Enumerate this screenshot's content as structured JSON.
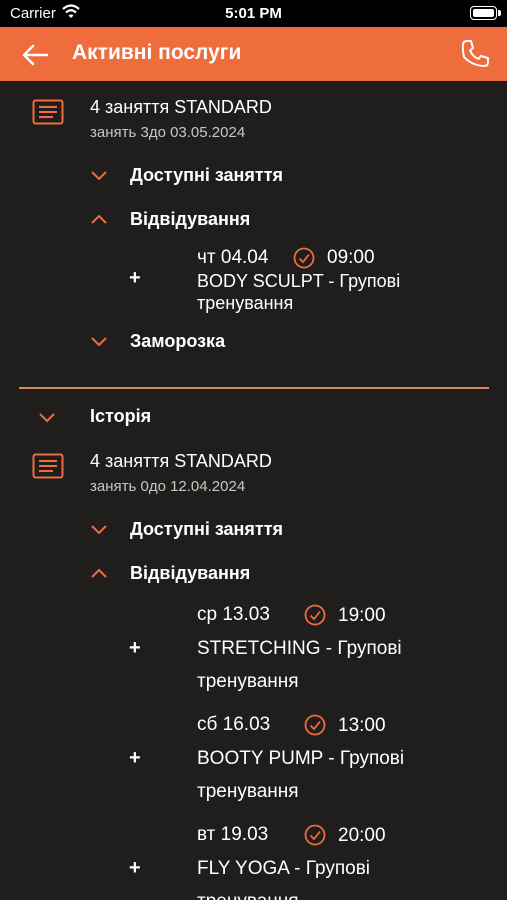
{
  "status_bar": {
    "carrier": "Carrier",
    "time": "5:01 PM"
  },
  "header": {
    "title": "Активні послуги",
    "back_icon": "arrow-left-icon",
    "call_icon": "phone-icon"
  },
  "active_package": {
    "title": "4 заняття STANDARD",
    "subtitle": "занять 3до 03.05.2024",
    "sections": {
      "available": "Доступні заняття",
      "visits": "Відвідування",
      "freeze": "Заморозка"
    },
    "visits": [
      {
        "date": "чт 04.04",
        "time": "09:00",
        "name": "BODY SCULPT - Групові тренування"
      }
    ]
  },
  "history": {
    "label": "Історія",
    "package": {
      "title": "4 заняття STANDARD",
      "subtitle": "занять 0до 12.04.2024",
      "sections": {
        "available": "Доступні заняття",
        "visits": "Відвідування"
      },
      "visits": [
        {
          "date": "ср 13.03",
          "time": "19:00",
          "name": "STRETCHING - Групові тренування"
        },
        {
          "date": "сб 16.03",
          "time": "13:00",
          "name": "BOOTY PUMP - Групові тренування"
        },
        {
          "date": "вт 19.03",
          "time": "20:00",
          "name": "FLY YOGA - Групові тренування"
        }
      ]
    }
  },
  "colors": {
    "accent": "#ef6c3c",
    "background": "#1f1e1d"
  }
}
